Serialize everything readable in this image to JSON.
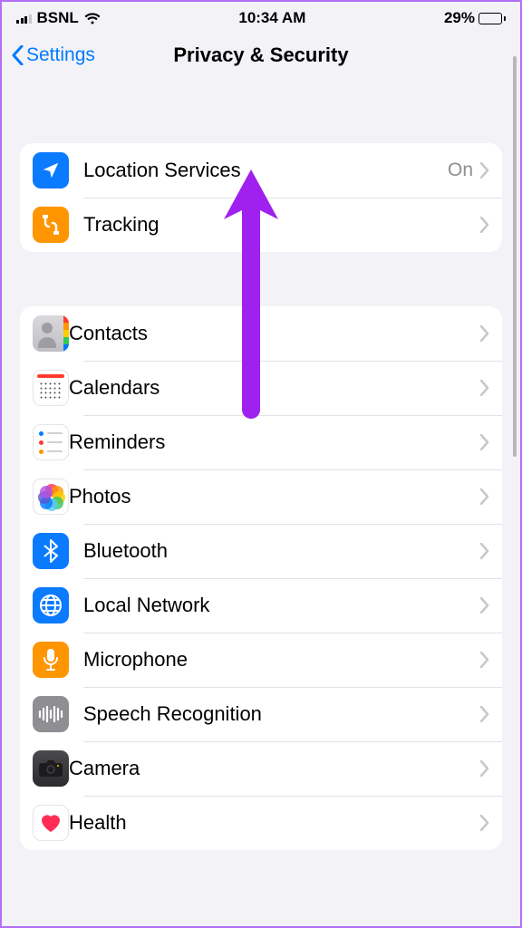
{
  "status": {
    "carrier": "BSNL",
    "time": "10:34 AM",
    "battery_pct": "29%"
  },
  "nav": {
    "back_label": "Settings",
    "title": "Privacy & Security"
  },
  "group1": [
    {
      "label": "Location Services",
      "value": "On"
    },
    {
      "label": "Tracking",
      "value": ""
    }
  ],
  "group2": [
    {
      "label": "Contacts"
    },
    {
      "label": "Calendars"
    },
    {
      "label": "Reminders"
    },
    {
      "label": "Photos"
    },
    {
      "label": "Bluetooth"
    },
    {
      "label": "Local Network"
    },
    {
      "label": "Microphone"
    },
    {
      "label": "Speech Recognition"
    },
    {
      "label": "Camera"
    },
    {
      "label": "Health"
    }
  ]
}
